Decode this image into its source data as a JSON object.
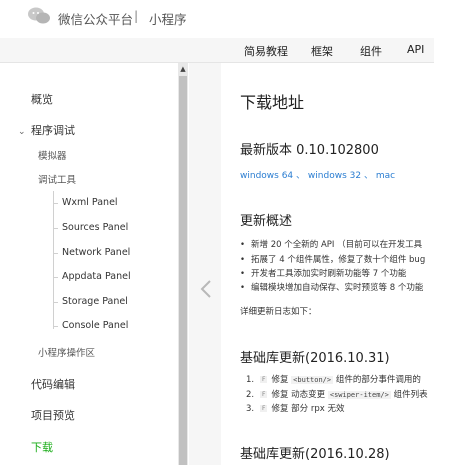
{
  "header": {
    "brand_name": "微信公众平台",
    "separator": "|",
    "brand_sub": "小程序"
  },
  "nav": {
    "items": [
      "简易教程",
      "框架",
      "组件",
      "API"
    ]
  },
  "sidebar": {
    "overview": "概览",
    "debug": "程序调试",
    "simulator": "模拟器",
    "debug_tools": "调试工具",
    "panels": [
      "Wxml Panel",
      "Sources Panel",
      "Network Panel",
      "Appdata Panel",
      "Storage Panel",
      "Console Panel"
    ],
    "operation_area": "小程序操作区",
    "code_edit": "代码编辑",
    "preview": "项目预览",
    "download": "下载"
  },
  "main": {
    "title": "下载地址",
    "latest_version": "最新版本 0.10.102800",
    "links": [
      "windows 64",
      "windows 32",
      "mac"
    ],
    "link_sep": "、",
    "update_heading": "更新概述",
    "bullets": [
      "新增 20 个全新的 API （目前可以在开发工具",
      "拓展了 4 个组件属性，修复了数十个组件 bug",
      "开发者工具添加实时刷新功能等 7 个功能",
      "编辑模块增加自动保存、实时预览等 8 个功能"
    ],
    "details_text": "详细更新日志如下：",
    "lib_update_1": "基础库更新(2016.10.31)",
    "fixes": [
      {
        "num": "1.",
        "tag": "F",
        "pre": "修复",
        "code": "<button/>",
        "post": "组件的部分事件调用的"
      },
      {
        "num": "2.",
        "tag": "F",
        "pre": "修复 动态变更",
        "code": "<swiper-item/>",
        "post": "组件列表"
      },
      {
        "num": "3.",
        "tag": "F",
        "pre": "修复 部分 rpx 无效",
        "code": "",
        "post": ""
      }
    ],
    "lib_update_2": "基础库更新(2016.10.28)"
  },
  "colors": {
    "accent_green": "#1aad19",
    "link_blue": "#2a7dd1"
  }
}
